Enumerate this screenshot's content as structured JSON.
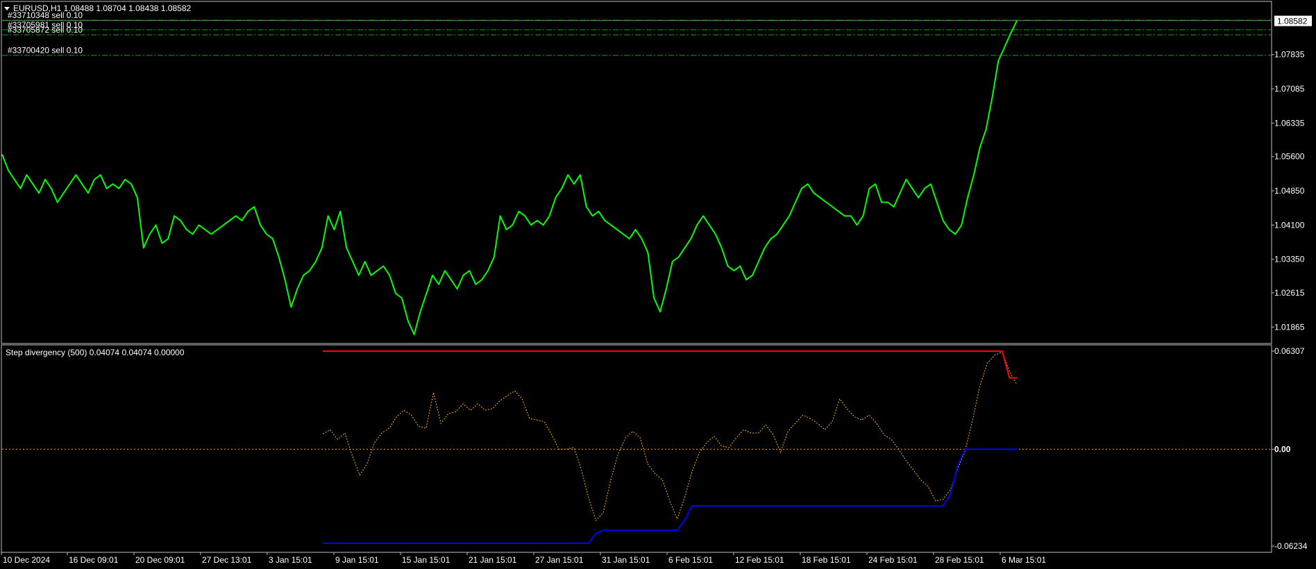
{
  "header": {
    "symbol_line": "EURUSD,H1  1.08488 1.08704 1.08438 1.08582",
    "orders": [
      {
        "label": "#33710348 sell 0.10",
        "price": 1.0859
      },
      {
        "label": "#33705981 sell 0.10",
        "price": 1.0838
      },
      {
        "label": "#33705872 sell 0.10",
        "price": 1.0827
      },
      {
        "label": "#33700420 sell 0.10",
        "price": 1.0782
      }
    ]
  },
  "colors": {
    "price": "#00ff00",
    "order_line": "#00b000",
    "osc": "#ffb000",
    "upper": "#ff0000",
    "lower": "#0000ff",
    "frame": "#c0c0c0",
    "label_bg": "#ffffff"
  },
  "chart_data": [
    {
      "type": "line",
      "title": "EURUSD,H1",
      "current_price": 1.08582,
      "ylim": [
        1.0155,
        1.0885
      ],
      "yticks": [
        "1.08582",
        "1.07835",
        "1.07085",
        "1.06335",
        "1.05600",
        "1.04850",
        "1.04100",
        "1.03350",
        "1.02615",
        "1.01865"
      ],
      "x_ticks": [
        "10 Dec 2024",
        "16 Dec 09:01",
        "20 Dec 09:01",
        "27 Dec 13:01",
        "3 Jan 15:01",
        "9 Jan 15:01",
        "15 Jan 15:01",
        "21 Jan 15:01",
        "27 Jan 15:01",
        "31 Jan 15:01",
        "6 Feb 15:01",
        "12 Feb 15:01",
        "18 Feb 15:01",
        "24 Feb 15:01",
        "28 Feb 15:01",
        "6 Mar 15:01"
      ],
      "series": [
        {
          "values": [
            1.0565,
            1.053,
            1.051,
            1.049,
            1.052,
            1.05,
            1.048,
            1.051,
            1.049,
            1.046,
            1.048,
            1.05,
            1.052,
            1.05,
            1.048,
            1.051,
            1.052,
            1.049,
            1.05,
            1.049,
            1.051,
            1.05,
            1.047,
            1.036,
            1.039,
            1.041,
            1.037,
            1.038,
            1.043,
            1.042,
            1.04,
            1.039,
            1.041,
            1.04,
            1.039,
            1.04,
            1.041,
            1.042,
            1.043,
            1.042,
            1.044,
            1.045,
            1.041,
            1.039,
            1.038,
            1.034,
            1.029,
            1.023,
            1.027,
            1.03,
            1.031,
            1.033,
            1.036,
            1.043,
            1.04,
            1.044,
            1.036,
            1.033,
            1.03,
            1.033,
            1.03,
            1.031,
            1.032,
            1.03,
            1.026,
            1.025,
            1.02,
            1.017,
            1.022,
            1.026,
            1.03,
            1.028,
            1.031,
            1.029,
            1.027,
            1.03,
            1.031,
            1.028,
            1.029,
            1.031,
            1.034,
            1.043,
            1.04,
            1.041,
            1.044,
            1.043,
            1.041,
            1.042,
            1.041,
            1.043,
            1.047,
            1.049,
            1.052,
            1.05,
            1.052,
            1.045,
            1.043,
            1.044,
            1.042,
            1.041,
            1.04,
            1.039,
            1.038,
            1.04,
            1.038,
            1.035,
            1.025,
            1.022,
            1.027,
            1.033,
            1.034,
            1.036,
            1.038,
            1.041,
            1.043,
            1.041,
            1.039,
            1.036,
            1.032,
            1.031,
            1.032,
            1.029,
            1.03,
            1.033,
            1.036,
            1.038,
            1.039,
            1.041,
            1.043,
            1.046,
            1.049,
            1.05,
            1.048,
            1.047,
            1.046,
            1.045,
            1.044,
            1.043,
            1.043,
            1.041,
            1.043,
            1.049,
            1.05,
            1.046,
            1.046,
            1.045,
            1.048,
            1.051,
            1.049,
            1.047,
            1.049,
            1.05,
            1.046,
            1.042,
            1.04,
            1.039,
            1.041,
            1.047,
            1.052,
            1.058,
            1.062,
            1.069,
            1.077,
            1.08,
            1.083,
            1.0858
          ]
        }
      ]
    },
    {
      "type": "line",
      "title": "Step divergency (500) 0.04074 0.04074 0.00000",
      "ylim": [
        -0.06234,
        0.06307
      ],
      "yticks": [
        "0.06307",
        "0.00",
        "-0.06234"
      ],
      "series": [
        {
          "name": "osc",
          "style": "dotted",
          "values": [
            0.0095,
            0.012,
            0.006,
            0.01,
            -0.004,
            -0.016,
            -0.009,
            0.004,
            0.01,
            0.013,
            0.02,
            0.024,
            0.021,
            0.014,
            0.013,
            0.035,
            0.016,
            0.022,
            0.023,
            0.028,
            0.024,
            0.028,
            0.024,
            0.025,
            0.03,
            0.033,
            0.036,
            0.031,
            0.019,
            0.018,
            0.017,
            0.009,
            0.0,
            0.0,
            0.001,
            -0.012,
            -0.03,
            -0.044,
            -0.039,
            -0.019,
            -0.003,
            0.007,
            0.011,
            0.007,
            -0.009,
            -0.015,
            -0.019,
            -0.032,
            -0.043,
            -0.03,
            -0.014,
            -0.002,
            0.004,
            0.008,
            0.002,
            0.001,
            0.007,
            0.012,
            0.01,
            0.01,
            0.015,
            0.009,
            -0.002,
            0.011,
            0.016,
            0.021,
            0.019,
            0.016,
            0.012,
            0.017,
            0.031,
            0.025,
            0.02,
            0.018,
            0.021,
            0.016,
            0.009,
            0.006,
            0.0,
            -0.007,
            -0.013,
            -0.019,
            -0.023,
            -0.032,
            -0.031,
            -0.025,
            -0.012,
            -0.001,
            0.018,
            0.039,
            0.053,
            0.058,
            0.06,
            0.048,
            0.04
          ]
        },
        {
          "name": "upper",
          "values": [
            0.0605,
            0.0605,
            0.0605,
            0.0605,
            0.0605,
            0.0605,
            0.0605,
            0.0605,
            0.0605,
            0.0605,
            0.0605,
            0.0605,
            0.0605,
            0.0605,
            0.0605,
            0.0605,
            0.0605,
            0.0605,
            0.0605,
            0.0605,
            0.0605,
            0.0605,
            0.0605,
            0.0605,
            0.0605,
            0.0605,
            0.0605,
            0.0605,
            0.0605,
            0.0605,
            0.0605,
            0.0605,
            0.0605,
            0.0605,
            0.0605,
            0.0605,
            0.0605,
            0.0605,
            0.0605,
            0.0605,
            0.0605,
            0.0605,
            0.0605,
            0.0605,
            0.0605,
            0.0605,
            0.0605,
            0.0605,
            0.0605,
            0.0605,
            0.0605,
            0.0605,
            0.0605,
            0.0605,
            0.0605,
            0.0605,
            0.0605,
            0.0605,
            0.0605,
            0.0605,
            0.0605,
            0.0605,
            0.0605,
            0.0605,
            0.0605,
            0.0605,
            0.0605,
            0.0605,
            0.0605,
            0.0605,
            0.0605,
            0.0605,
            0.0605,
            0.0605,
            0.0605,
            0.0605,
            0.0605,
            0.0605,
            0.0605,
            0.0605,
            0.0605,
            0.0605,
            0.0605,
            0.0605,
            0.0605,
            0.0605,
            0.0605,
            0.0605,
            0.0605,
            0.0605,
            0.0605,
            0.0605,
            0.0605,
            0.044,
            0.044
          ]
        },
        {
          "name": "lower",
          "values": [
            -0.058,
            -0.058,
            -0.058,
            -0.058,
            -0.058,
            -0.058,
            -0.058,
            -0.058,
            -0.058,
            -0.058,
            -0.058,
            -0.058,
            -0.058,
            -0.058,
            -0.058,
            -0.058,
            -0.058,
            -0.058,
            -0.058,
            -0.058,
            -0.058,
            -0.058,
            -0.058,
            -0.058,
            -0.058,
            -0.058,
            -0.058,
            -0.058,
            -0.058,
            -0.058,
            -0.058,
            -0.058,
            -0.058,
            -0.058,
            -0.058,
            -0.058,
            -0.058,
            -0.052,
            -0.05,
            -0.05,
            -0.05,
            -0.05,
            -0.05,
            -0.05,
            -0.05,
            -0.05,
            -0.05,
            -0.05,
            -0.05,
            -0.044,
            -0.035,
            -0.035,
            -0.035,
            -0.035,
            -0.035,
            -0.035,
            -0.035,
            -0.035,
            -0.035,
            -0.035,
            -0.035,
            -0.035,
            -0.035,
            -0.035,
            -0.035,
            -0.035,
            -0.035,
            -0.035,
            -0.035,
            -0.035,
            -0.035,
            -0.035,
            -0.035,
            -0.035,
            -0.035,
            -0.035,
            -0.035,
            -0.035,
            -0.035,
            -0.035,
            -0.035,
            -0.035,
            -0.035,
            -0.035,
            -0.035,
            -0.028,
            -0.01,
            0.0,
            0.0,
            0.0,
            0.0,
            0.0,
            0.0,
            0.0,
            0.0
          ]
        }
      ]
    }
  ]
}
